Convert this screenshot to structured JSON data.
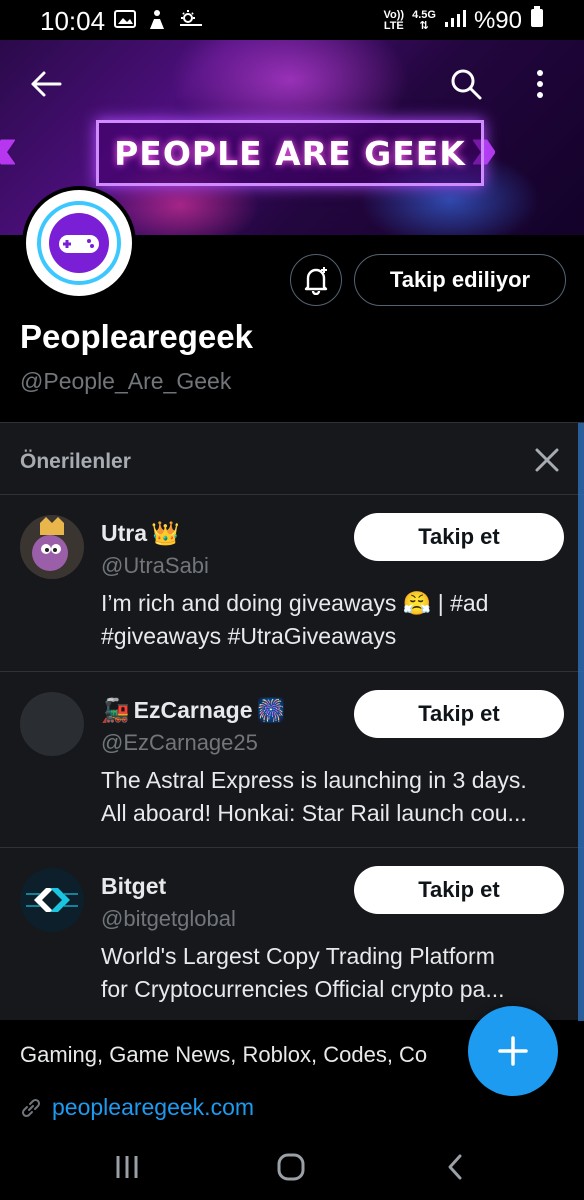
{
  "status_bar": {
    "time": "10:04",
    "network_top": "Vo))",
    "network_bottom": "LTE",
    "data_top": "4.5G",
    "battery": "%90"
  },
  "banner": {
    "title": "PEOPLE ARE GEEK"
  },
  "profile": {
    "follow_state_label": "Takip ediliyor",
    "name": "Peoplearegeek",
    "handle": "@People_Are_Geek",
    "bio": "Gaming, Game News, Roblox, Codes, Co",
    "link": "peoplearegeek.com"
  },
  "suggestions": {
    "header": "Önerilenler",
    "items": [
      {
        "name": "Utra",
        "emoji": "👑",
        "handle": "@UtraSabi",
        "bio_line1": "I’m rich and doing giveaways 😤 | #ad",
        "bio_line2": "#giveaways #UtraGiveaways",
        "follow_label": "Takip et"
      },
      {
        "name": "EzCarnage",
        "emoji_prefix": "🚂",
        "emoji": "🎆",
        "handle": "@EzCarnage25",
        "bio_line1": "The Astral Express is launching in 3 days.",
        "bio_line2": "All aboard! Honkai: Star Rail launch cou...",
        "follow_label": "Takip et"
      },
      {
        "name": "Bitget",
        "handle": "@bitgetglobal",
        "bio_line1": "World's Largest Copy Trading Platform",
        "bio_line2": "for Cryptocurrencies   Official crypto pa...",
        "follow_label": "Takip et"
      }
    ]
  },
  "colors": {
    "accent": "#1d9bf0",
    "panel_bg": "#16181c",
    "muted_text": "#71767b"
  }
}
